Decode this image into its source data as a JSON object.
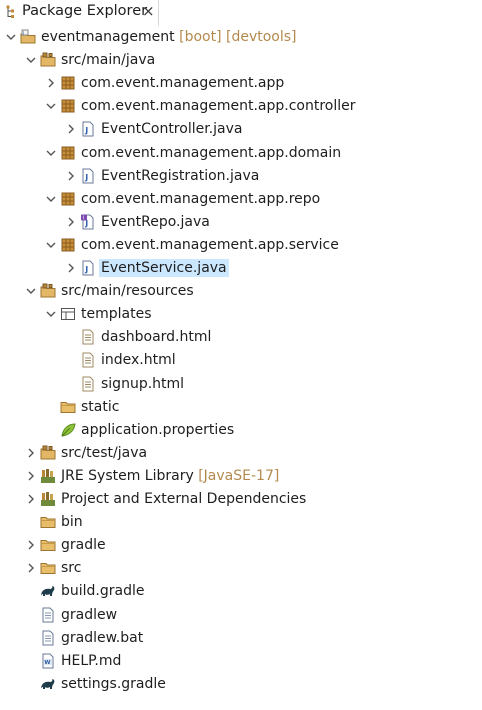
{
  "tab": {
    "title": "Package Explorer",
    "close": "×"
  },
  "tree": [
    {
      "depth": 0,
      "arrow": "down",
      "icon": "project",
      "label": "eventmanagement",
      "deco": " [boot] [devtools]"
    },
    {
      "depth": 1,
      "arrow": "down",
      "icon": "src-folder",
      "label": "src/main/java"
    },
    {
      "depth": 2,
      "arrow": "right",
      "icon": "package",
      "label": "com.event.management.app"
    },
    {
      "depth": 2,
      "arrow": "down",
      "icon": "package",
      "label": "com.event.management.app.controller"
    },
    {
      "depth": 3,
      "arrow": "right",
      "icon": "java-file",
      "label": "EventController.java"
    },
    {
      "depth": 2,
      "arrow": "down",
      "icon": "package",
      "label": "com.event.management.app.domain"
    },
    {
      "depth": 3,
      "arrow": "right",
      "icon": "java-file",
      "label": "EventRegistration.java"
    },
    {
      "depth": 2,
      "arrow": "down",
      "icon": "package",
      "label": "com.event.management.app.repo"
    },
    {
      "depth": 3,
      "arrow": "right",
      "icon": "java-interface-file",
      "label": "EventRepo.java"
    },
    {
      "depth": 2,
      "arrow": "down",
      "icon": "package",
      "label": "com.event.management.app.service"
    },
    {
      "depth": 3,
      "arrow": "right",
      "icon": "java-file",
      "label": "EventService.java",
      "selected": true
    },
    {
      "depth": 1,
      "arrow": "down",
      "icon": "src-folder",
      "label": "src/main/resources"
    },
    {
      "depth": 2,
      "arrow": "down",
      "icon": "templates-folder",
      "label": "templates"
    },
    {
      "depth": 3,
      "arrow": "none",
      "icon": "html-file",
      "label": "dashboard.html"
    },
    {
      "depth": 3,
      "arrow": "none",
      "icon": "html-file",
      "label": "index.html"
    },
    {
      "depth": 3,
      "arrow": "none",
      "icon": "html-file",
      "label": "signup.html"
    },
    {
      "depth": 2,
      "arrow": "none",
      "icon": "folder",
      "label": "static"
    },
    {
      "depth": 2,
      "arrow": "none",
      "icon": "properties-file",
      "label": "application.properties"
    },
    {
      "depth": 1,
      "arrow": "right",
      "icon": "src-folder",
      "label": "src/test/java"
    },
    {
      "depth": 1,
      "arrow": "right",
      "icon": "library",
      "label": "JRE System Library",
      "deco": " [JavaSE-17]"
    },
    {
      "depth": 1,
      "arrow": "right",
      "icon": "library",
      "label": "Project and External Dependencies"
    },
    {
      "depth": 1,
      "arrow": "none",
      "icon": "folder",
      "label": "bin"
    },
    {
      "depth": 1,
      "arrow": "right",
      "icon": "folder",
      "label": "gradle"
    },
    {
      "depth": 1,
      "arrow": "right",
      "icon": "folder",
      "label": "src"
    },
    {
      "depth": 1,
      "arrow": "none",
      "icon": "gradle-file",
      "label": "build.gradle"
    },
    {
      "depth": 1,
      "arrow": "none",
      "icon": "text-file",
      "label": "gradlew"
    },
    {
      "depth": 1,
      "arrow": "none",
      "icon": "text-file",
      "label": "gradlew.bat"
    },
    {
      "depth": 1,
      "arrow": "none",
      "icon": "markdown-file",
      "label": "HELP.md"
    },
    {
      "depth": 1,
      "arrow": "none",
      "icon": "gradle-file",
      "label": "settings.gradle"
    }
  ]
}
